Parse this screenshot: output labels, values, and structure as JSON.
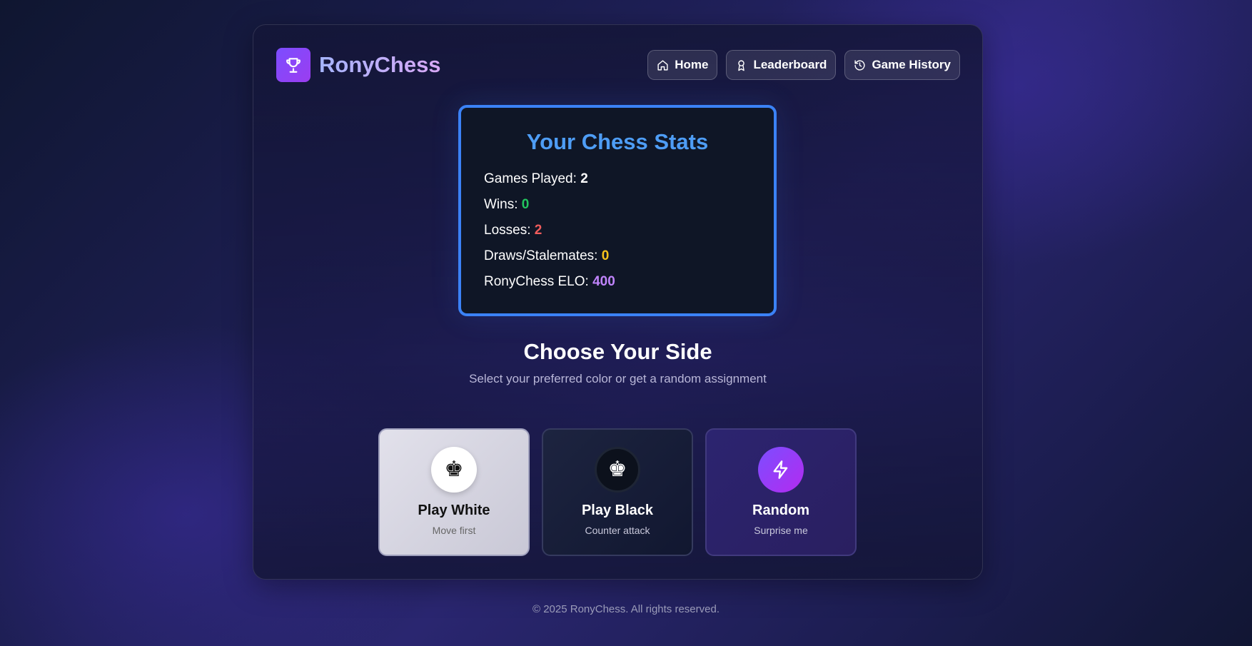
{
  "app": {
    "name": "RonyChess"
  },
  "nav": [
    {
      "label": "Home",
      "icon": "home-icon"
    },
    {
      "label": "Leaderboard",
      "icon": "award-icon"
    },
    {
      "label": "Game History",
      "icon": "history-icon"
    }
  ],
  "stats": {
    "title": "Your Chess Stats",
    "rows": [
      {
        "label": "Games Played:",
        "value": "2",
        "color": "#ffffff"
      },
      {
        "label": "Wins:",
        "value": "0",
        "color": "#22c55e"
      },
      {
        "label": "Losses:",
        "value": "2",
        "color": "#f05c5c"
      },
      {
        "label": "Draws/Stalemates:",
        "value": "0",
        "color": "#f7c31b"
      },
      {
        "label": "RonyChess ELO:",
        "value": "400",
        "color": "#c084fc"
      }
    ]
  },
  "choose": {
    "title": "Choose Your Side",
    "subtitle": "Select your preferred color or get a random assignment",
    "options": [
      {
        "title": "Play White",
        "subtitle": "Move first",
        "icon": "white-king-icon",
        "glyph": "♚"
      },
      {
        "title": "Play Black",
        "subtitle": "Counter attack",
        "icon": "black-king-icon",
        "glyph": "♚"
      },
      {
        "title": "Random",
        "subtitle": "Surprise me",
        "icon": "lightning-icon"
      }
    ]
  },
  "footer": {
    "text": "© 2025 RonyChess. All rights reserved."
  },
  "colors": {
    "accent": "#7c4dff",
    "statsBorder": "#3b82f6",
    "statsTitle": "#4e9df5"
  }
}
